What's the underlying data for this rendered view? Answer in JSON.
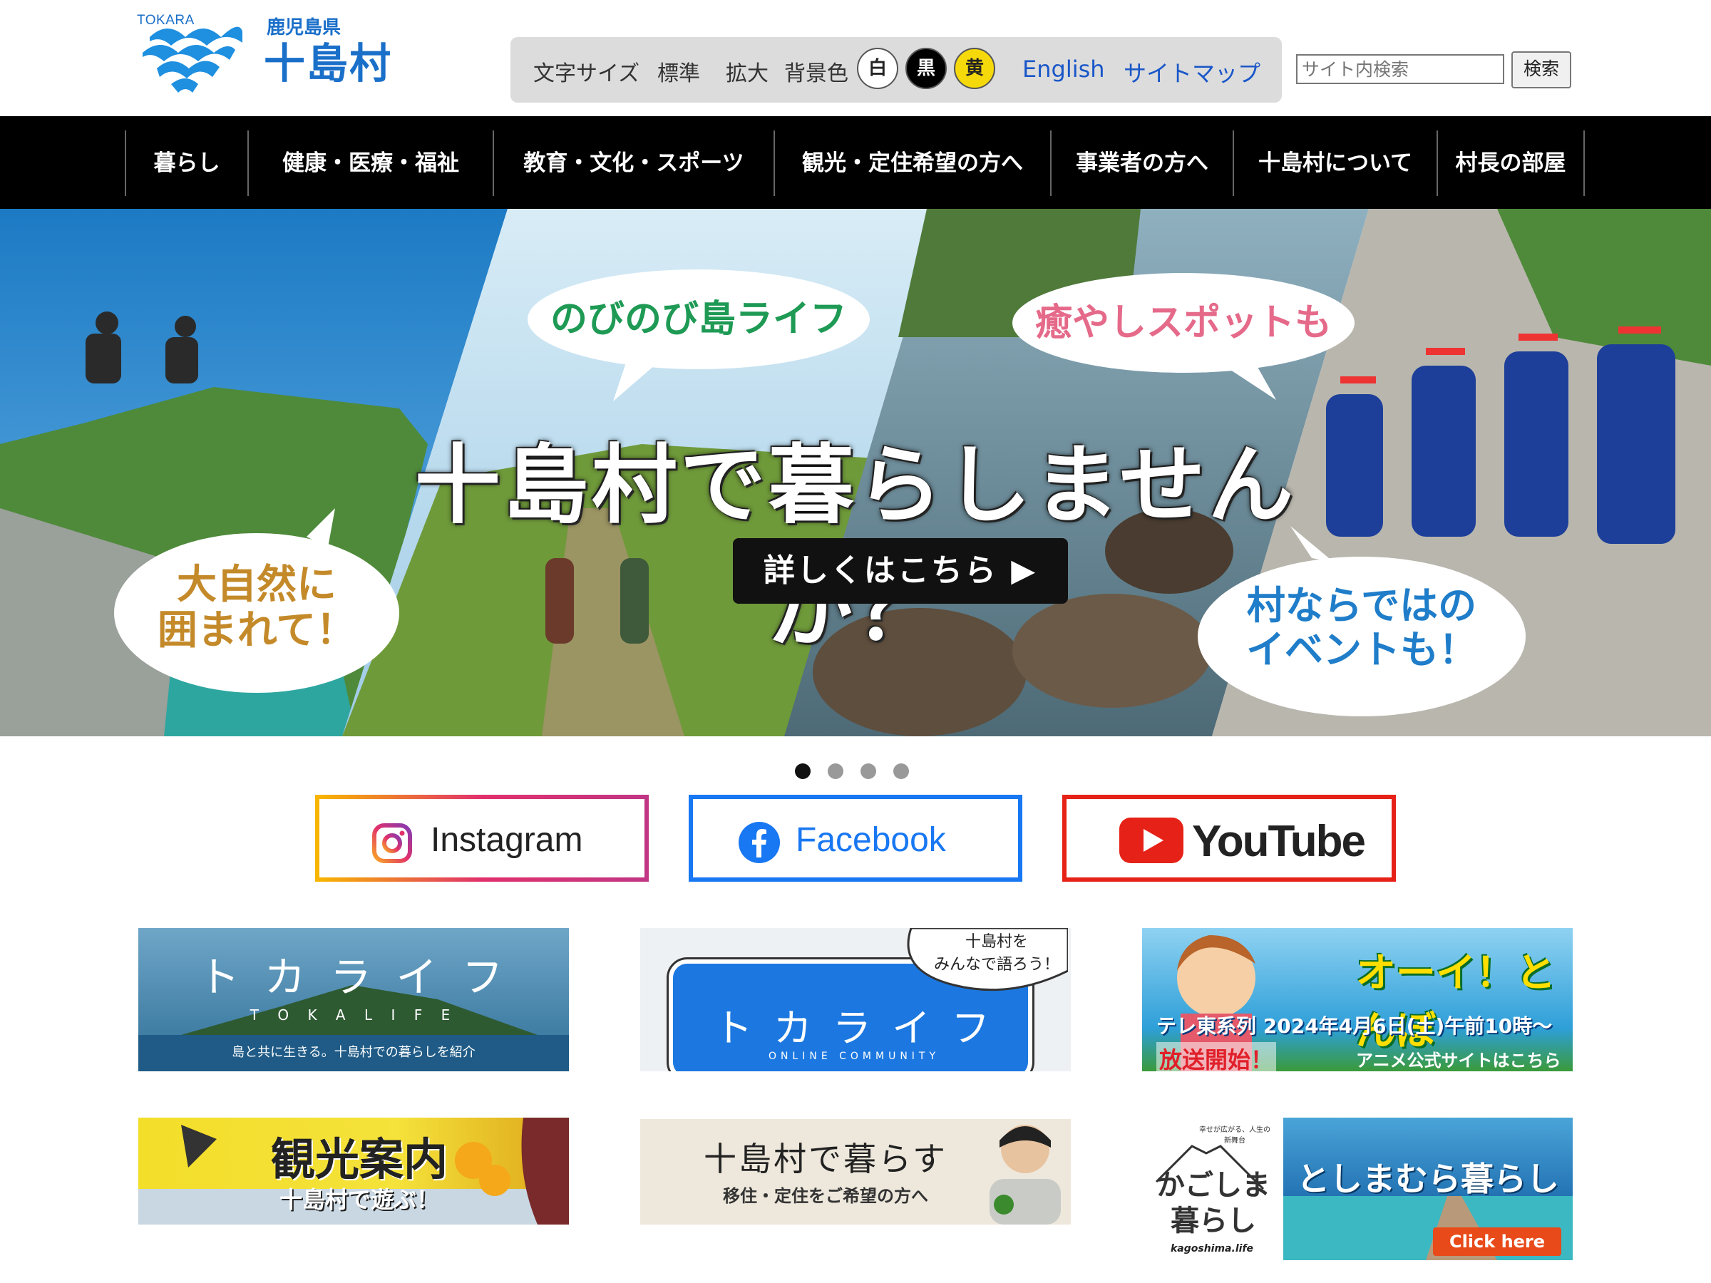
{
  "header": {
    "logo_small": "TOKARA",
    "prefecture": "鹿児島県",
    "village": "十島村"
  },
  "toolbar": {
    "font_size_label": "文字サイズ",
    "font_standard": "標準",
    "font_large": "拡大",
    "bg_color_label": "背景色",
    "bg_white": "白",
    "bg_black": "黒",
    "bg_yellow": "黄",
    "english": "English",
    "sitemap": "サイトマップ"
  },
  "search": {
    "placeholder": "サイト内検索",
    "button": "検索"
  },
  "nav": {
    "items": [
      {
        "label": "暮らし"
      },
      {
        "label": "健康・医療・福祉"
      },
      {
        "label": "教育・文化・スポーツ"
      },
      {
        "label": "観光・定住希望の方へ"
      },
      {
        "label": "事業者の方へ"
      },
      {
        "label": "十島村について"
      },
      {
        "label": "村長の部屋"
      }
    ]
  },
  "hero": {
    "bubble1": "のびのび島ライフ",
    "bubble2": "癒やしスポットも",
    "bubble3_line1": "大自然に",
    "bubble3_line2": "囲まれて！",
    "bubble4_line1": "村ならではの",
    "bubble4_line2": "イベントも！",
    "headline": "十島村で暮らしませんか？",
    "cta": "詳しくはこちら ▶"
  },
  "carousel": {
    "slides": 4,
    "active": 1
  },
  "social": {
    "instagram": "Instagram",
    "facebook": "Facebook",
    "youtube": "YouTube"
  },
  "banners": {
    "tokalife": {
      "title": "ト カ ラ イ フ",
      "subtitle": "T O K A L I F E",
      "caption": "島と共に生きる。十島村での暮らしを紹介"
    },
    "community": {
      "title": "ト カ ラ イ フ",
      "subtitle": "ONLINE COMMUNITY",
      "note_line1": "十島村を",
      "note_line2": "みんなで語ろう！"
    },
    "anime": {
      "title": "オーイ！とんぼ",
      "broadcast": "テレ東系列 2024年4月6日(土)午前10時〜",
      "start": "放送開始！",
      "link": "アニメ公式サイトはこちら"
    },
    "tourism": {
      "title": "観光案内",
      "subtitle": "十島村で遊ぶ！"
    },
    "living": {
      "title": "十島村で暮らす",
      "subtitle": "移住・定住をご希望の方へ"
    },
    "kagoshima": {
      "small": "幸せが広がる、人生の新舞台",
      "title_line1": "かごしま",
      "title_line2": "暮らし",
      "url": "kagoshima.life"
    },
    "toshima": {
      "title": "としまむら暮らし",
      "cta": "Click here"
    }
  },
  "colors": {
    "brand_blue": "#1a6fc9",
    "link_blue": "#1a57c8",
    "facebook_blue": "#1877f2",
    "youtube_red": "#e62117"
  }
}
